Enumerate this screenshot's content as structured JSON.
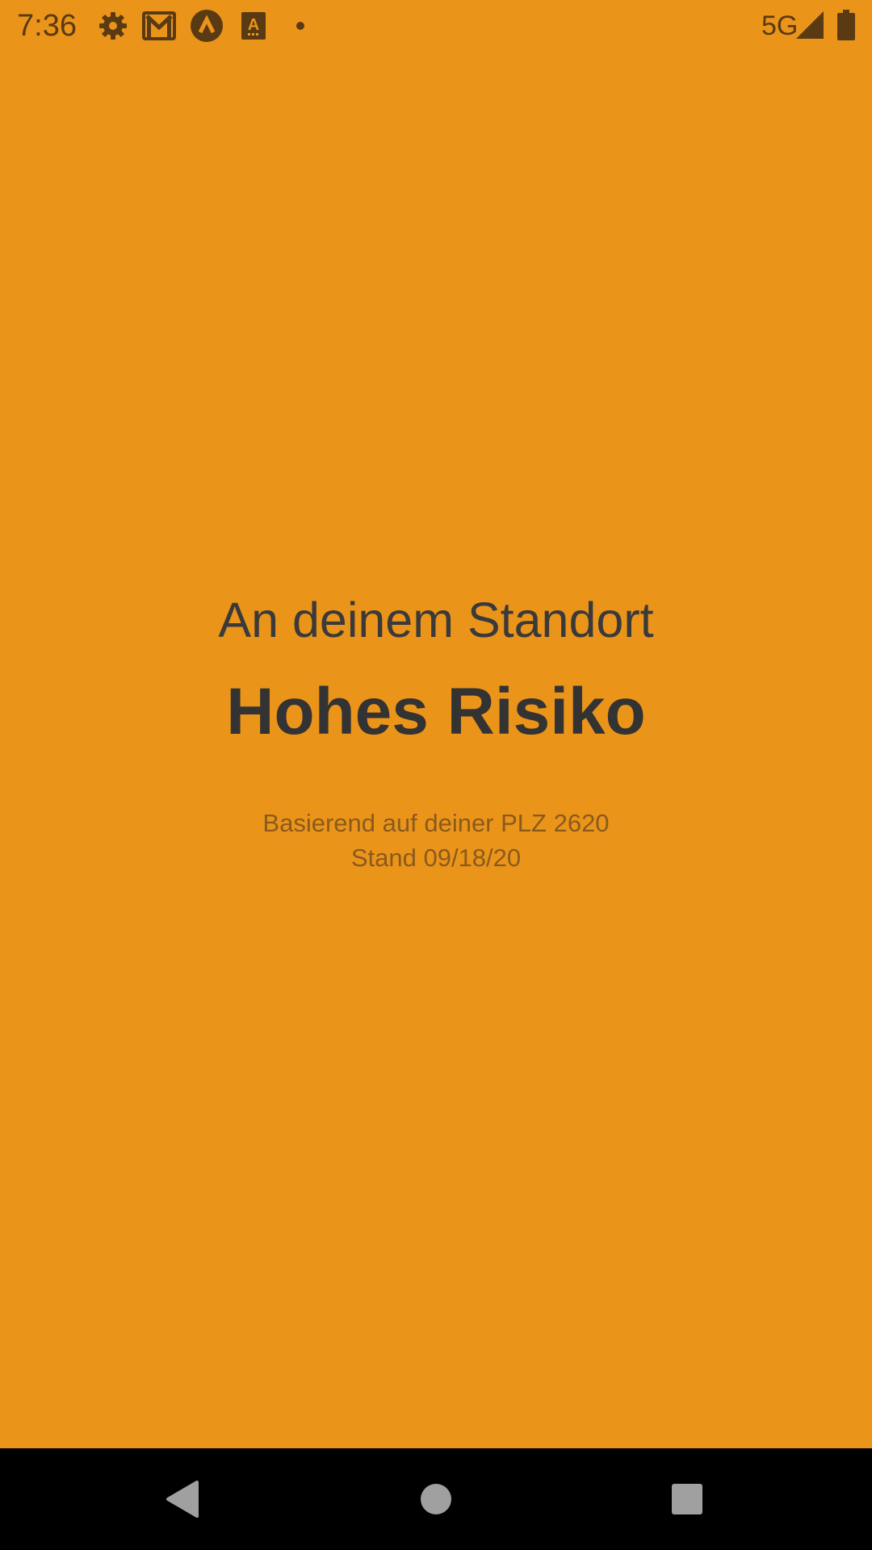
{
  "status_bar": {
    "time": "7:36",
    "network": "5G",
    "icons": [
      "settings-icon",
      "gmail-icon",
      "app-arrow-icon",
      "text-a-icon",
      "notification-dot-icon",
      "signal-icon",
      "battery-icon"
    ]
  },
  "main": {
    "subtitle": "An deinem Standort",
    "title": "Hohes Risiko",
    "basis_line": "Basierend auf deiner PLZ 2620",
    "date_line": "Stand 09/18/20"
  },
  "nav_bar": {
    "buttons": [
      "back-button",
      "home-button",
      "recents-button"
    ]
  },
  "colors": {
    "background": "#EB941A",
    "text_dark": "#333333",
    "text_muted": "#8a5a1c",
    "status_icon": "#5a3a12",
    "nav_background": "#000000"
  }
}
